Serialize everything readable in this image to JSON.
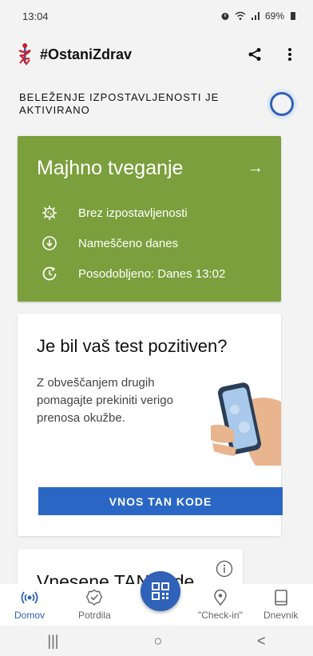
{
  "status": {
    "time": "13:04",
    "battery": "69%"
  },
  "app": {
    "title": "#OstaniZdrav"
  },
  "exposure": {
    "label": "BELEŽENJE IZPOSTAVLJENOSTI JE AKTIVIRANO",
    "enabled": true
  },
  "risk_card": {
    "title": "Majhno tveganje",
    "rows": [
      {
        "icon": "virus-icon",
        "text": "Brez izpostavljenosti"
      },
      {
        "icon": "download-icon",
        "text": "Nameščeno danes"
      },
      {
        "icon": "clock-icon",
        "text": "Posodobljeno: Danes 13:02"
      }
    ],
    "color": "#7b9f3c"
  },
  "test_card": {
    "title": "Je bil vaš test pozitiven?",
    "body": "Z obveščanjem drugih pomagajte prekiniti verigo prenosa okužbe.",
    "button": "VNOS TAN KODE"
  },
  "tan_card": {
    "title": "Vnesene TAN kode"
  },
  "bottom_nav": [
    {
      "icon": "broadcast-icon",
      "label": "Domov",
      "active": true
    },
    {
      "icon": "badge-check-icon",
      "label": "Potrdila",
      "active": false
    },
    {
      "icon": "location-pin-icon",
      "label": "\"Check-in\"",
      "active": false
    },
    {
      "icon": "book-icon",
      "label": "Dnevnik",
      "active": false
    }
  ],
  "system_nav": {
    "recents": "|||",
    "home": "○",
    "back": "<"
  },
  "accent": "#2f62b8"
}
